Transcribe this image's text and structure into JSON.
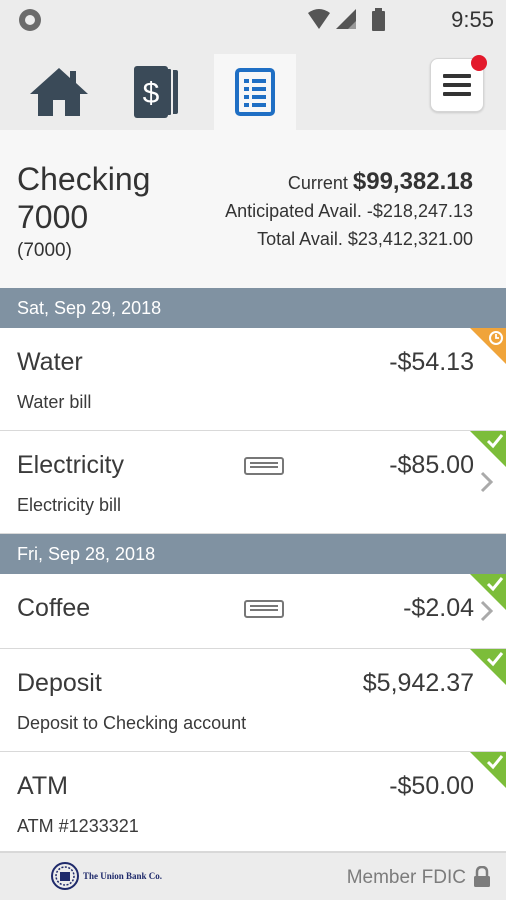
{
  "status_bar": {
    "time": "9:55"
  },
  "nav": {
    "tabs": [
      {
        "icon": "home-icon"
      },
      {
        "icon": "dollar-stack-icon"
      },
      {
        "icon": "list-document-icon",
        "active": true
      }
    ],
    "menu_icon": "hamburger-menu-icon",
    "badge_color": "#e3192b"
  },
  "account": {
    "name": "Checking 7000",
    "number": "(7000)",
    "current_label": "Current",
    "current_value": "$99,382.18",
    "anticipated_label": "Anticipated Avail.",
    "anticipated_value": "-$218,247.13",
    "total_label": "Total Avail.",
    "total_value": "$23,412,321.00"
  },
  "groups": [
    {
      "date": "Sat, Sep 29, 2018",
      "transactions": [
        {
          "title": "Water",
          "description": "Water bill",
          "amount": "-$54.13",
          "status": "pending"
        },
        {
          "title": "Electricity",
          "description": "Electricity bill",
          "amount": "-$85.00",
          "status": "cleared",
          "has_memo": true,
          "has_chevron": true
        }
      ]
    },
    {
      "date": "Fri, Sep 28, 2018",
      "transactions": [
        {
          "title": "Coffee",
          "description": "",
          "amount": "-$2.04",
          "status": "cleared",
          "has_memo": true,
          "has_chevron": true
        },
        {
          "title": "Deposit",
          "description": "Deposit to Checking account",
          "amount": "$5,942.37",
          "status": "cleared"
        },
        {
          "title": "ATM",
          "description": "ATM #1233321",
          "amount": "-$50.00",
          "status": "cleared"
        }
      ]
    }
  ],
  "footer": {
    "bank_name": "The Union Bank Co.",
    "fdic_text": "Member FDIC"
  },
  "colors": {
    "date_header": "#8092a2",
    "cleared": "#7cbd3a",
    "pending": "#f0a43a",
    "active_tab_icon": "#1f6fc4"
  }
}
